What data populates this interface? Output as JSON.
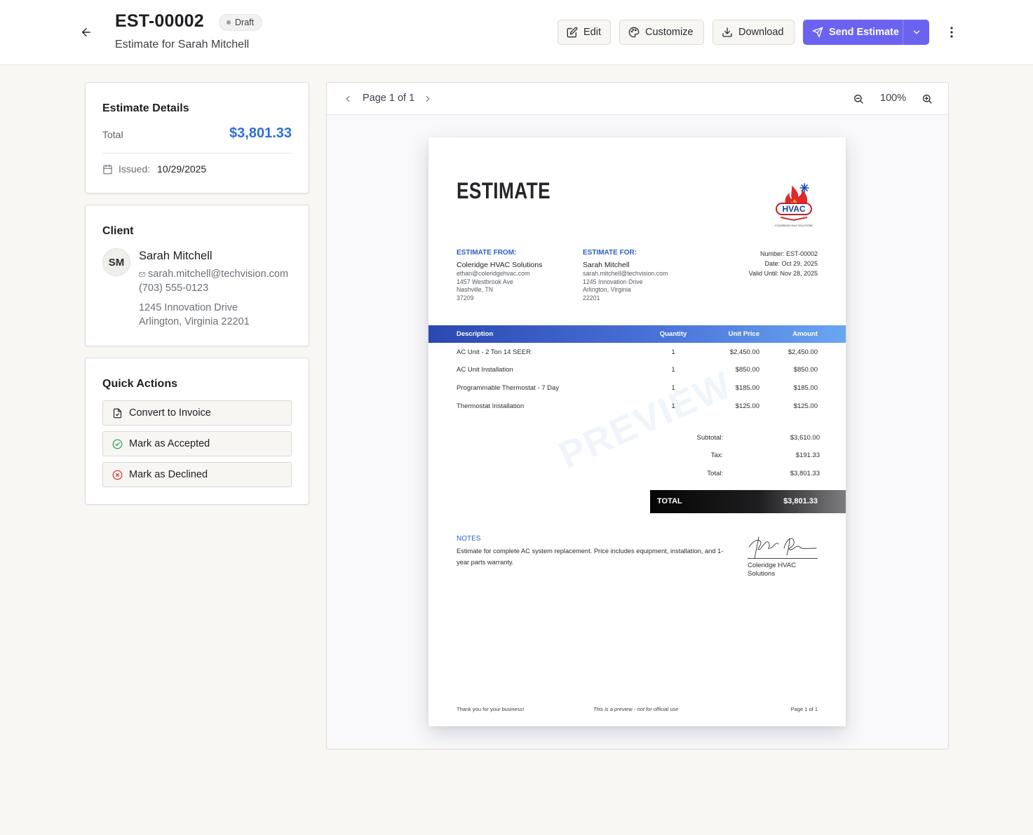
{
  "header": {
    "estimate_number": "EST-00002",
    "status": "Draft",
    "subtitle": "Estimate for Sarah Mitchell",
    "buttons": {
      "edit": "Edit",
      "customize": "Customize",
      "download": "Download",
      "send": "Send Estimate"
    }
  },
  "details": {
    "title": "Estimate Details",
    "total_label": "Total",
    "total_value": "$3,801.33",
    "issued_label": "Issued:",
    "issued_value": "10/29/2025"
  },
  "client": {
    "title": "Client",
    "initials": "SM",
    "name": "Sarah Mitchell",
    "email": "sarah.mitchell@techvision.com",
    "phone": "(703) 555-0123",
    "address_line1": "1245 Innovation Drive",
    "address_line2": "Arlington, Virginia 22201"
  },
  "quick_actions": {
    "title": "Quick Actions",
    "items": [
      "Convert to Invoice",
      "Mark as Accepted",
      "Mark as Declined"
    ]
  },
  "preview": {
    "page_label": "Page 1 of 1",
    "zoom": "100%"
  },
  "document": {
    "title": "ESTIMATE",
    "logo_text": "HVAC",
    "logo_caption": "COLERIDGE HVAC SOLUTIONS",
    "from_label": "ESTIMATE FROM:",
    "from": {
      "name": "Coleridge HVAC Solutions",
      "email": "ethan@coleridgehvac.com",
      "street": "1457 Westbrook Ave",
      "city": "Nashville, TN",
      "zip": "37209"
    },
    "for_label": "ESTIMATE FOR:",
    "for": {
      "name": "Sarah Mitchell",
      "email": "sarah.mitchell@techvision.com",
      "street": "1245 Innovation Drive",
      "city": "Arlington, Virginia",
      "zip": "22201"
    },
    "meta": {
      "number": "Number: EST-00002",
      "date": "Date: Oct 29, 2025",
      "valid": "Valid Until: Nov 28, 2025"
    },
    "columns": {
      "description": "Description",
      "quantity": "Quantity",
      "unit_price": "Unit Price",
      "amount": "Amount"
    },
    "items": [
      {
        "description": "AC Unit - 2 Ton 14 SEER",
        "quantity": "1",
        "unit_price": "$2,450.00",
        "amount": "$2,450.00"
      },
      {
        "description": "AC Unit Installation",
        "quantity": "1",
        "unit_price": "$850.00",
        "amount": "$850.00"
      },
      {
        "description": "Programmable Thermostat - 7 Day",
        "quantity": "1",
        "unit_price": "$185.00",
        "amount": "$185.00"
      },
      {
        "description": "Thermostat Installation",
        "quantity": "1",
        "unit_price": "$125.00",
        "amount": "$125.00"
      }
    ],
    "subtotal_label": "Subtotal:",
    "subtotal": "$3,610.00",
    "tax_label": "Tax:",
    "tax": "$191.33",
    "total_label": "Total:",
    "total": "$3,801.33",
    "grand_label": "TOTAL",
    "grand_total": "$3,801.33",
    "watermark": "PREVIEW",
    "notes_label": "NOTES",
    "notes": "Estimate for complete AC system replacement. Price includes equipment, installation, and 1-year parts warranty.",
    "signature_name": "Coleridge HVAC Solutions",
    "footer_left": "Thank you for your business!",
    "footer_center": "This is a preview - not for official use",
    "footer_right": "Page 1 of 1"
  },
  "colors": {
    "accent": "#6b63f0",
    "total_blue": "#2f6fd6",
    "doc_blue": "#2d5fc4"
  }
}
